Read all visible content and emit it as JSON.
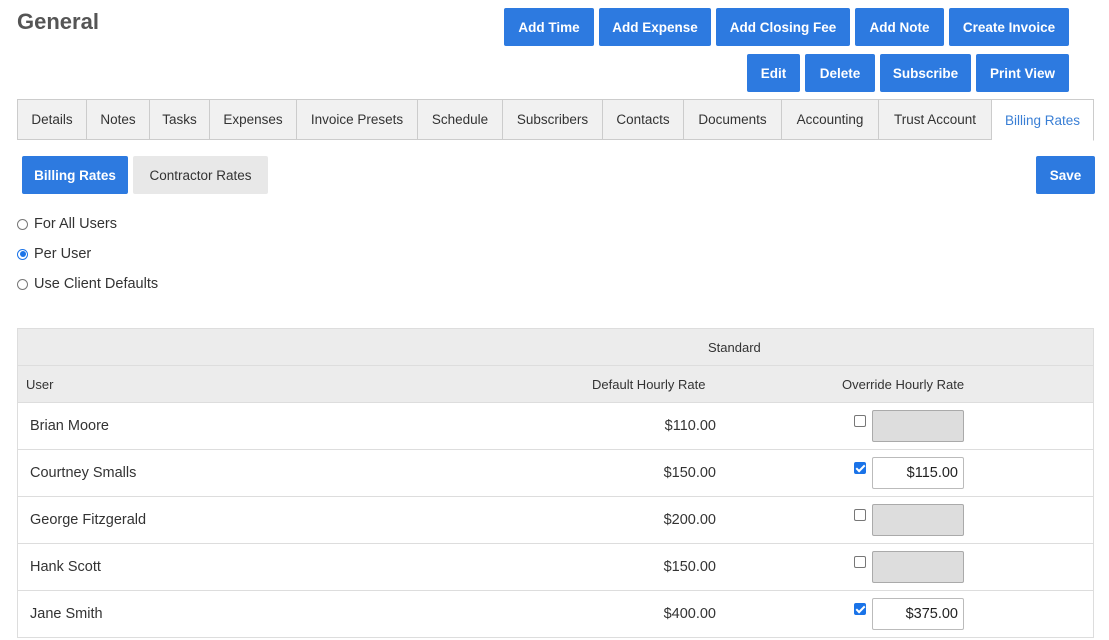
{
  "page": {
    "title": "General"
  },
  "toolbar": {
    "row1": [
      "Add Time",
      "Add Expense",
      "Add Closing Fee",
      "Add Note",
      "Create Invoice"
    ],
    "row2": [
      "Edit",
      "Delete",
      "Subscribe",
      "Print View"
    ]
  },
  "tabs": [
    "Details",
    "Notes",
    "Tasks",
    "Expenses",
    "Invoice Presets",
    "Schedule",
    "Subscribers",
    "Contacts",
    "Documents",
    "Accounting",
    "Trust Account",
    "Billing Rates"
  ],
  "active_tab": "Billing Rates",
  "subtabs": {
    "billing": "Billing Rates",
    "contractor": "Contractor Rates",
    "save": "Save"
  },
  "rate_mode": {
    "options": [
      "For All Users",
      "Per User",
      "Use Client Defaults"
    ],
    "selected": "Per User"
  },
  "table": {
    "group_header": "Standard",
    "columns": {
      "user": "User",
      "default": "Default Hourly Rate",
      "override": "Override Hourly Rate"
    },
    "rows": [
      {
        "user": "Brian Moore",
        "default": "$110.00",
        "override_checked": false,
        "override_value": ""
      },
      {
        "user": "Courtney Smalls",
        "default": "$150.00",
        "override_checked": true,
        "override_value": "$115.00"
      },
      {
        "user": "George Fitzgerald",
        "default": "$200.00",
        "override_checked": false,
        "override_value": ""
      },
      {
        "user": "Hank Scott",
        "default": "$150.00",
        "override_checked": false,
        "override_value": ""
      },
      {
        "user": "Jane Smith",
        "default": "$400.00",
        "override_checked": true,
        "override_value": "$375.00"
      }
    ]
  },
  "colors": {
    "primary": "#2d7ae0",
    "active_tab_text": "#3a7fd5",
    "header_bg": "#ececec"
  }
}
